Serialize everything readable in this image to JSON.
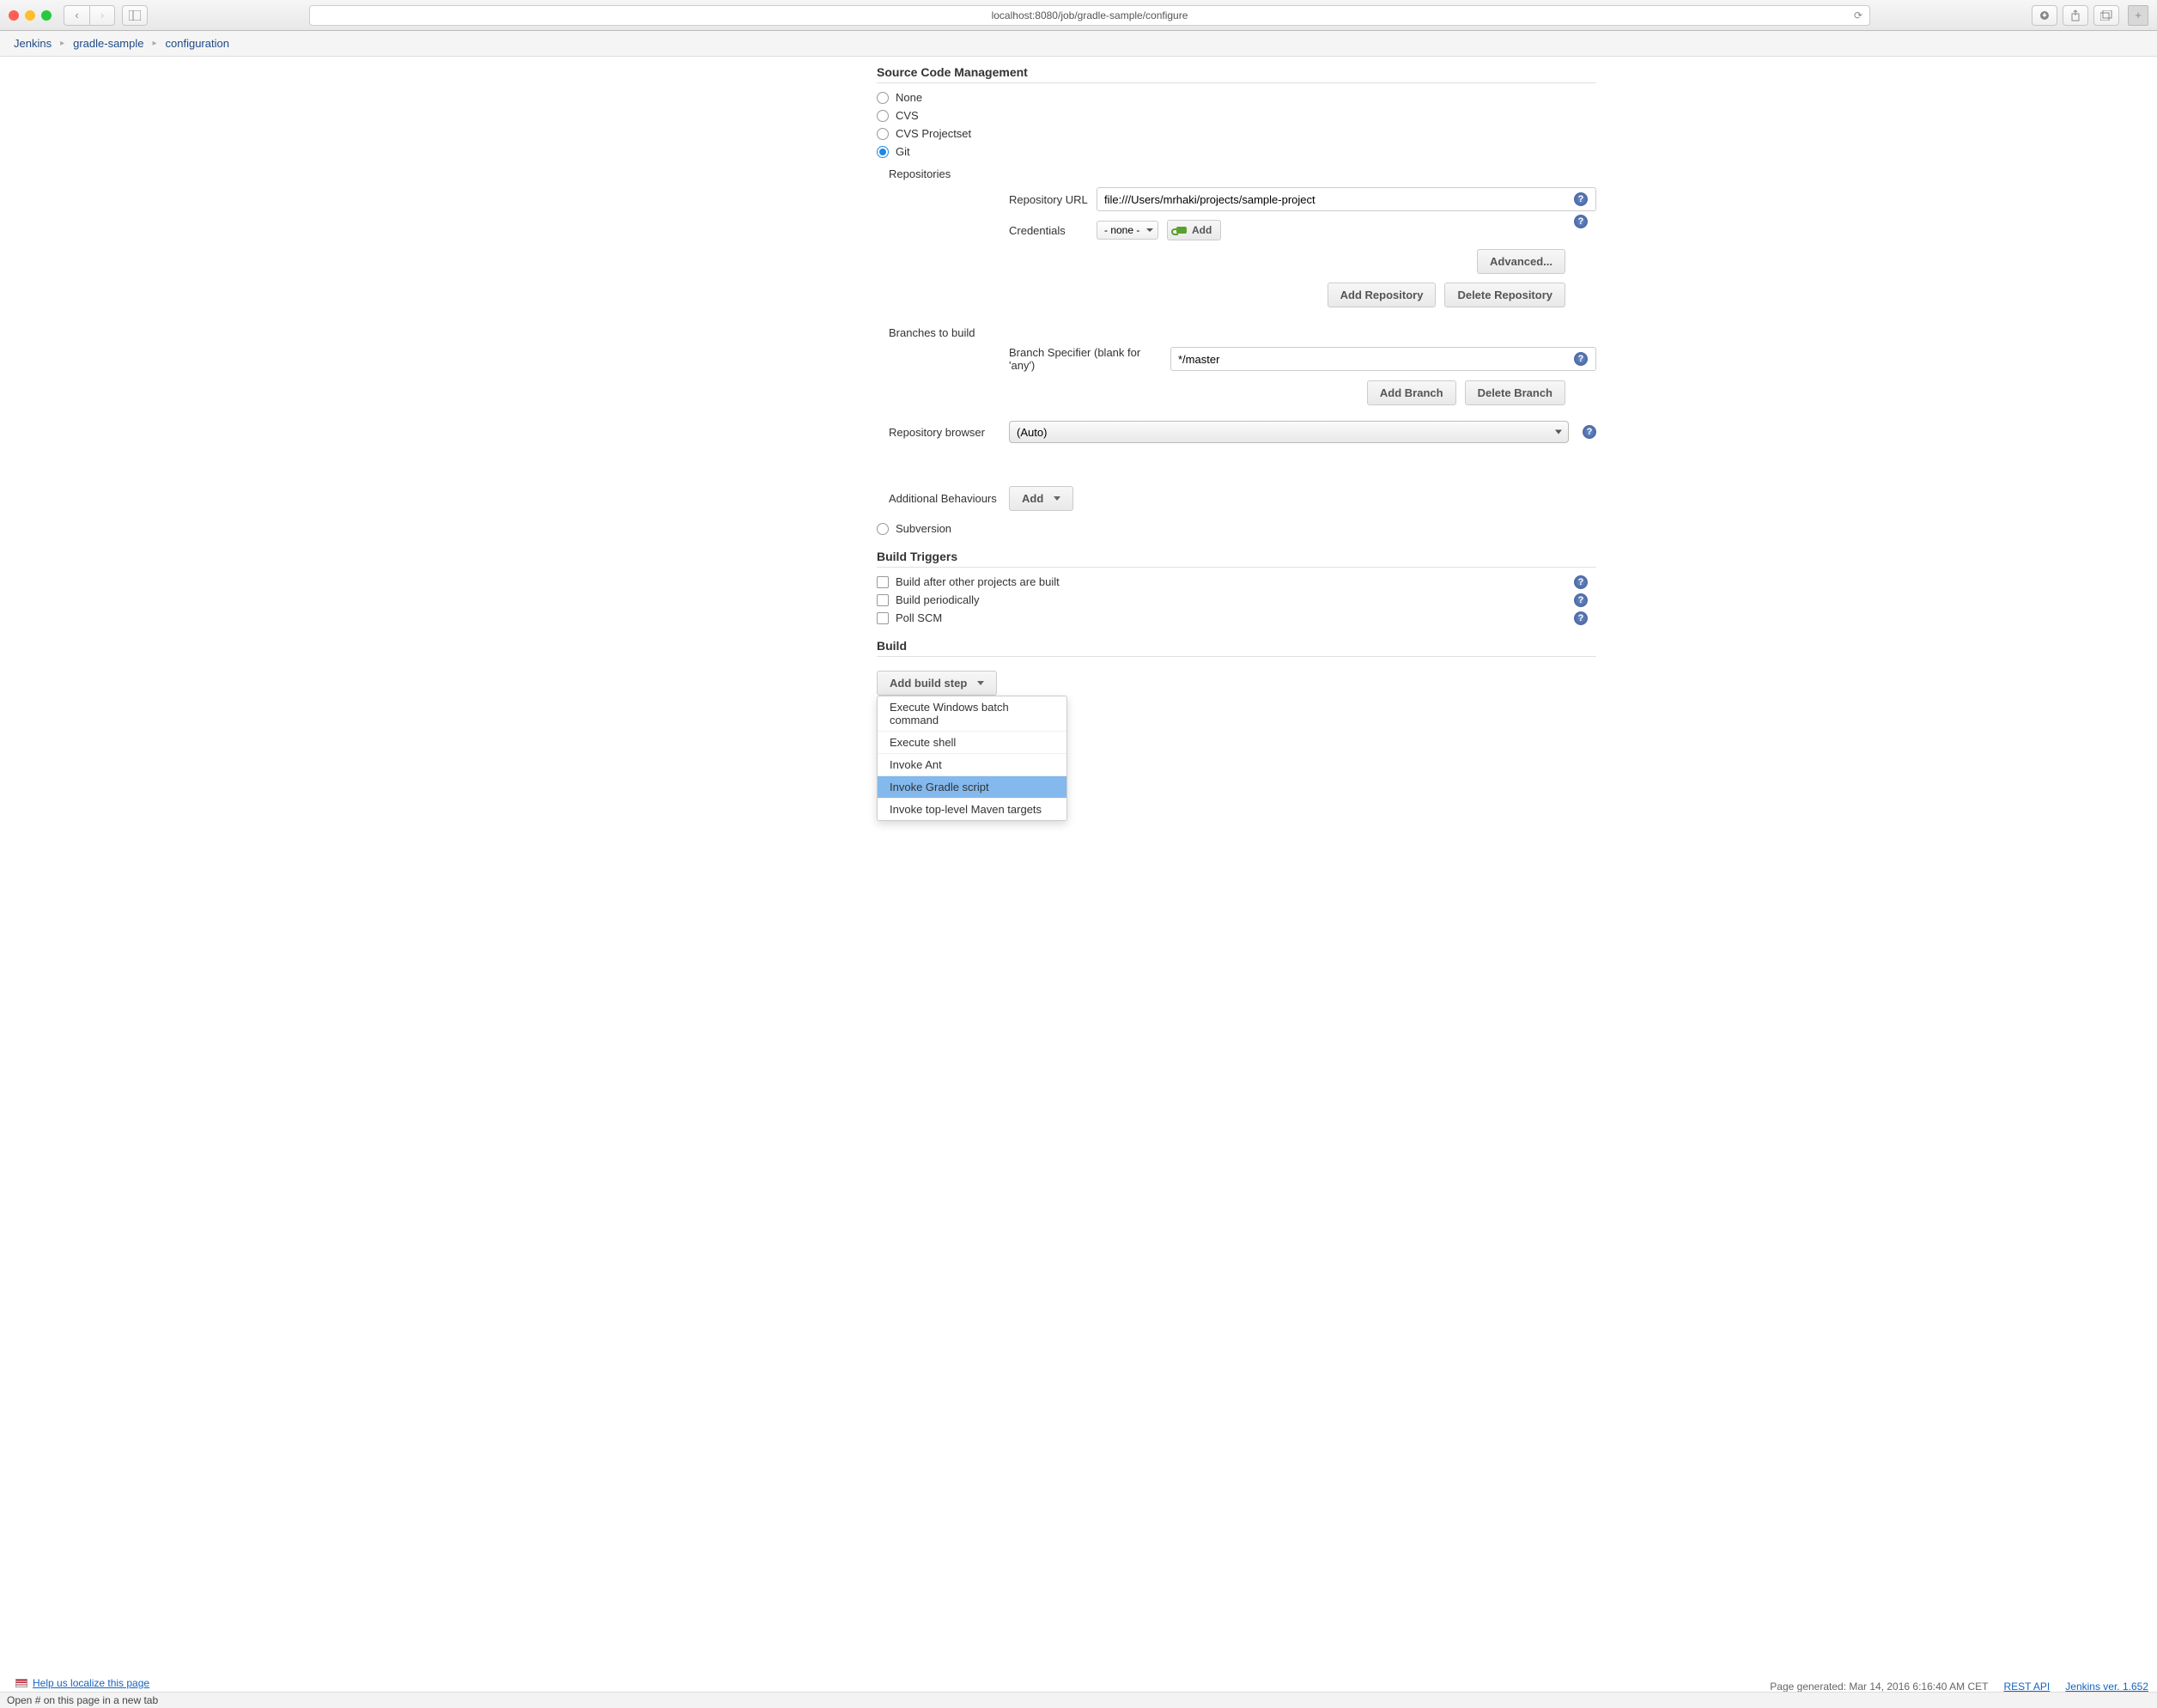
{
  "url": "localhost:8080/job/gradle-sample/configure",
  "breadcrumbs": [
    "Jenkins",
    "gradle-sample",
    "configuration"
  ],
  "scm": {
    "title": "Source Code Management",
    "options": {
      "none": "None",
      "cvs": "CVS",
      "cvs_projectset": "CVS Projectset",
      "git": "Git",
      "subversion": "Subversion"
    },
    "selected": "git",
    "git": {
      "repositories_label": "Repositories",
      "repository_url_label": "Repository URL",
      "repository_url_value": "file:///Users/mrhaki/projects/sample-project",
      "credentials_label": "Credentials",
      "credentials_value": "- none -",
      "add_button": "Add",
      "advanced_button": "Advanced...",
      "add_repository_button": "Add Repository",
      "delete_repository_button": "Delete Repository",
      "branches_label": "Branches to build",
      "branch_specifier_label": "Branch Specifier (blank for 'any')",
      "branch_specifier_value": "*/master",
      "add_branch_button": "Add Branch",
      "delete_branch_button": "Delete Branch",
      "repo_browser_label": "Repository browser",
      "repo_browser_value": "(Auto)",
      "additional_behaviours_label": "Additional Behaviours",
      "additional_add_button": "Add"
    }
  },
  "build_triggers": {
    "title": "Build Triggers",
    "options": {
      "after_projects": "Build after other projects are built",
      "periodically": "Build periodically",
      "poll_scm": "Poll SCM"
    }
  },
  "build": {
    "title": "Build",
    "add_step_button": "Add build step",
    "menu": {
      "exec_batch": "Execute Windows batch command",
      "exec_shell": "Execute shell",
      "invoke_ant": "Invoke Ant",
      "invoke_gradle": "Invoke Gradle script",
      "invoke_maven": "Invoke top-level Maven targets"
    },
    "highlighted": "invoke_gradle"
  },
  "footer": {
    "page_generated": "Page generated: Mar 14, 2016 6:16:40 AM CET",
    "rest_api": "REST API",
    "version": "Jenkins ver. 1.652",
    "localize": "Help us localize this page",
    "status": "Open # on this page in a new tab"
  }
}
